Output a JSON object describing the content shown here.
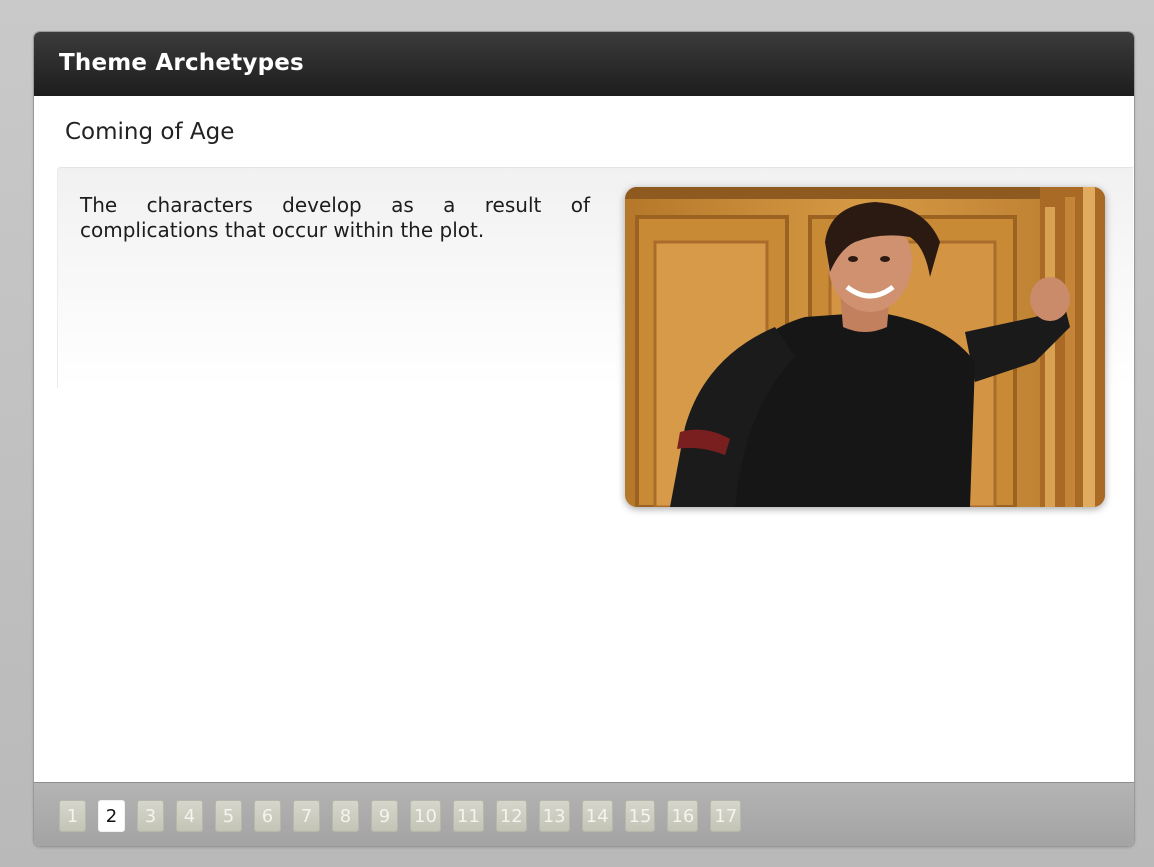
{
  "header": {
    "title": "Theme Archetypes"
  },
  "slide": {
    "subtitle": "Coming of Age",
    "body": "The characters develop as a result of complications that occur within the plot."
  },
  "pager": {
    "pages": [
      "1",
      "2",
      "3",
      "4",
      "5",
      "6",
      "7",
      "8",
      "9",
      "10",
      "11",
      "12",
      "13",
      "14",
      "15",
      "16",
      "17"
    ],
    "current": "2"
  },
  "colors": {
    "header_bg": "#262626",
    "footer_bg": "#aaaaaa",
    "page_btn": "#cfcfc3",
    "page_btn_active": "#ffffff"
  }
}
